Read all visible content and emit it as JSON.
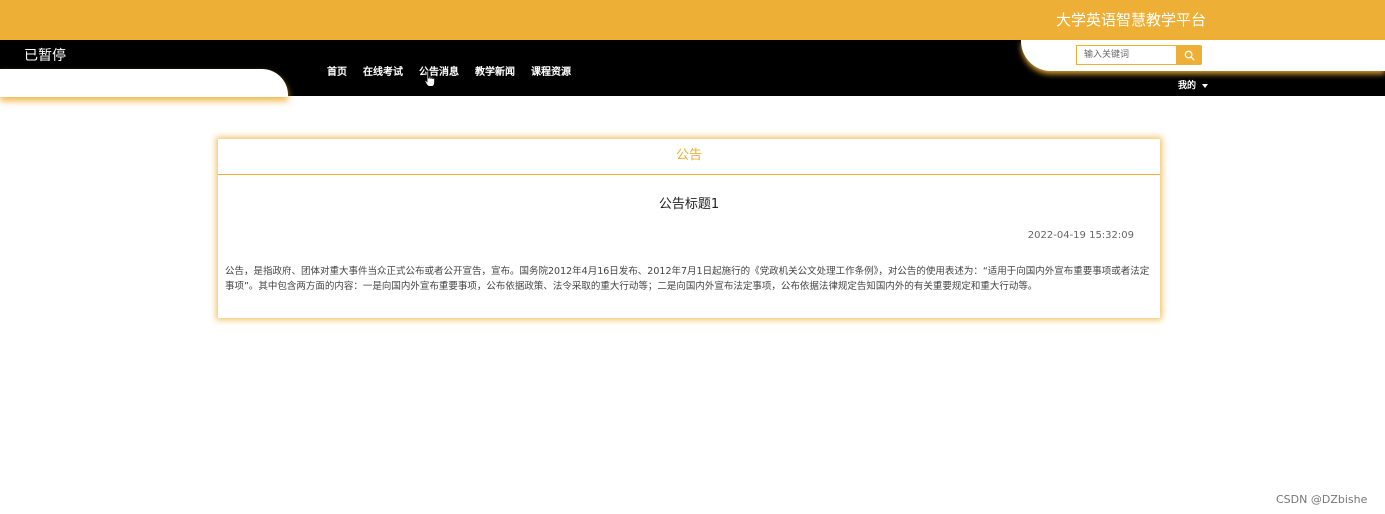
{
  "header": {
    "site_title": "大学英语智慧教学平台",
    "status_text": "已暂停"
  },
  "nav": {
    "items": [
      {
        "label": "首页"
      },
      {
        "label": "在线考试"
      },
      {
        "label": "公告消息"
      },
      {
        "label": "教学新闻"
      },
      {
        "label": "课程资源"
      }
    ]
  },
  "search": {
    "placeholder": "输入关键词",
    "button_icon": "search-icon"
  },
  "user_menu": {
    "label": "我的",
    "icon": "caret-down-icon"
  },
  "notice": {
    "section_label": "公告",
    "title": "公告标题1",
    "timestamp": "2022-04-19 15:32:09",
    "content": "公告，是指政府、团体对重大事件当众正式公布或者公开宣告，宣布。国务院2012年4月16日发布、2012年7月1日起施行的《党政机关公文处理工作条例》，对公告的使用表述为：“适用于向国内外宣布重要事项或者法定事项”。其中包含两方面的内容：一是向国内外宣布重要事项，公布依据政策、法令采取的重大行动等；二是向国内外宣布法定事项，公布依据法律规定告知国内外的有关重要规定和重大行动等。"
  },
  "watermark": "CSDN @DZbishe",
  "colors": {
    "accent": "#EDAF35",
    "nav_background": "#000000",
    "page_background": "#ffffff"
  }
}
